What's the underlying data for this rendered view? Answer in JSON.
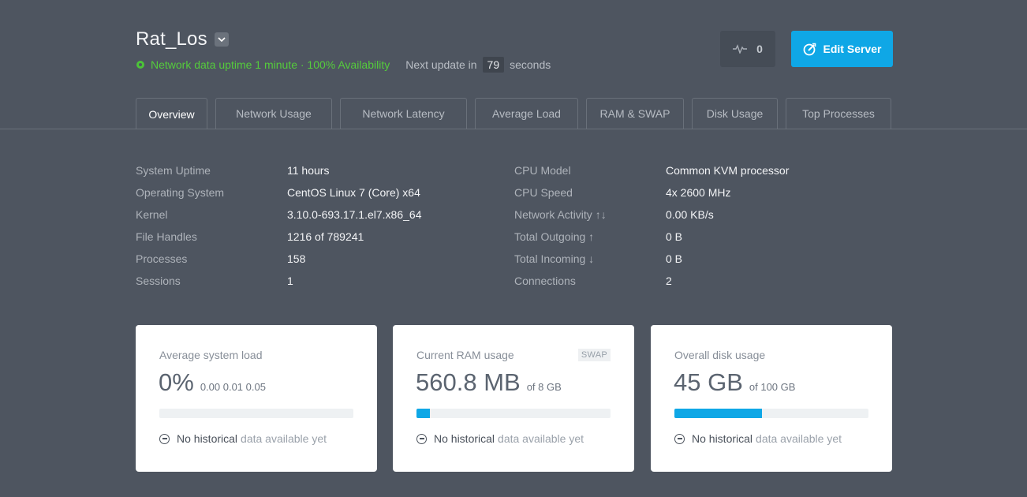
{
  "server": {
    "name": "Rat_Los",
    "status_text": "Network data uptime 1 minute · 100% Availability",
    "next_update_label": "Next update in",
    "next_update_value": "79",
    "next_update_unit": "seconds"
  },
  "toolbar": {
    "activity_count": "0",
    "edit_label": "Edit Server"
  },
  "tabs": [
    {
      "label": "Overview",
      "active": true
    },
    {
      "label": "Network Usage"
    },
    {
      "label": "Network Latency"
    },
    {
      "label": "Average Load"
    },
    {
      "label": "RAM & SWAP"
    },
    {
      "label": "Disk Usage"
    },
    {
      "label": "Top Processes"
    }
  ],
  "info_left": [
    {
      "label": "System Uptime",
      "value": "11 hours"
    },
    {
      "label": "Operating System",
      "value": "CentOS Linux 7 (Core) x64"
    },
    {
      "label": "Kernel",
      "value": "3.10.0-693.17.1.el7.x86_64"
    },
    {
      "label": "File Handles",
      "value": "1216 of 789241"
    },
    {
      "label": "Processes",
      "value": "158"
    },
    {
      "label": "Sessions",
      "value": "1"
    }
  ],
  "info_right": [
    {
      "label": "CPU Model",
      "value": "Common KVM processor"
    },
    {
      "label": "CPU Speed",
      "value": "4x 2600 MHz"
    },
    {
      "label": "Network Activity ↑↓",
      "value": "0.00 KB/s"
    },
    {
      "label": "Total Outgoing ↑",
      "value": "0 B"
    },
    {
      "label": "Total Incoming ↓",
      "value": "0 B"
    },
    {
      "label": "Connections",
      "value": "2"
    }
  ],
  "cards": [
    {
      "title": "Average system load",
      "big": "0%",
      "small": "0.00 0.01 0.05",
      "progress": 0,
      "nohist_dark": "No historical",
      "nohist_light": "data available yet"
    },
    {
      "title": "Current RAM usage",
      "badge": "SWAP",
      "big": "560.8 MB",
      "small": "of 8 GB",
      "progress": 0.07,
      "nohist_dark": "No historical",
      "nohist_light": "data available yet"
    },
    {
      "title": "Overall disk usage",
      "big": "45 GB",
      "small": "of 100 GB",
      "progress": 0.45,
      "nohist_dark": "No historical",
      "nohist_light": "data available yet"
    }
  ],
  "colors": {
    "accent": "#0fa7e6",
    "status_green": "#55cc3c",
    "background": "#4e5560"
  },
  "icons": {
    "dropdown": "chevron-down-icon",
    "activity": "pulse-icon",
    "edit": "edit-icon",
    "status": "status-circle-icon",
    "no_history": "minus-circle-icon"
  }
}
